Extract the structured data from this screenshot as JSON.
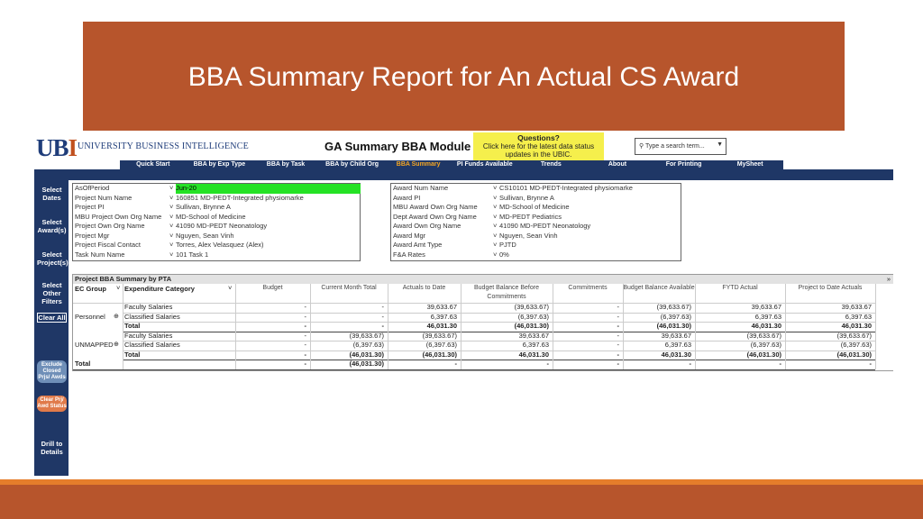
{
  "slide": {
    "title": "BBA Summary Report for An Actual CS Award"
  },
  "colors": {
    "banner": "#b7552c",
    "navy": "#1f3766",
    "highlight": "#25e225",
    "questions": "#f5ef4c",
    "strip": "#e57d2b"
  },
  "header": {
    "logo_u": "U",
    "logo_b": "B",
    "logo_i": "I",
    "subtitle": "UNIVERSITY BUSINESS INTELLIGENCE",
    "module_title": "GA Summary BBA Module",
    "questions_title": "Questions?",
    "questions_text": "Click here for the latest data status updates in the UBIC.",
    "search_placeholder": "Type a search term...",
    "search_icon": "search-icon"
  },
  "nav": [
    "Quick Start",
    "BBA by Exp Type",
    "BBA by Task",
    "BBA by Child Org",
    "BBA Summary",
    "PI Funds Available",
    "Trends",
    "About",
    "For Printing",
    "MySheet"
  ],
  "nav_active": "BBA Summary",
  "sidebar": {
    "select_dates": "Select Dates",
    "select_award": "Select Award(s)",
    "select_project": "Select Project(s)",
    "select_other": "Select Other Filters",
    "clear_all": "Clear All",
    "exclude": "Exclude Closed Prjs/ Awds",
    "clear_prj": "Clear Prj/ Awd Status",
    "drill": "Drill to Details"
  },
  "filters_left": [
    {
      "label": "AsOfPeriod",
      "value": "Jun-20",
      "highlight": true
    },
    {
      "label": "Project Num Name",
      "value": "160851 MD-PEDT-Integrated physiomarke"
    },
    {
      "label": "Project PI",
      "value": "Sullivan, Brynne A"
    },
    {
      "label": "MBU Project Own Org Name",
      "value": "MD-School of Medicine"
    },
    {
      "label": "Project Own Org Name",
      "value": "41090 MD-PEDT Neonatology"
    },
    {
      "label": "Project Mgr",
      "value": "Nguyen, Sean Vinh"
    },
    {
      "label": "Project Fiscal Contact",
      "value": "Torres, Alex Velasquez (Alex)"
    },
    {
      "label": "Task Num Name",
      "value": "101 Task 1"
    }
  ],
  "filters_right": [
    {
      "label": "Award Num Name",
      "value": "CS10101 MD-PEDT-Integrated physiomarke"
    },
    {
      "label": "Award PI",
      "value": "Sullivan, Brynne A"
    },
    {
      "label": "MBU Award Own Org Name",
      "value": "MD-School of Medicine"
    },
    {
      "label": "Dept Award Own Org Name",
      "value": "MD-PEDT Pediatrics"
    },
    {
      "label": "Award Own Org Name",
      "value": "41090 MD-PEDT Neonatology"
    },
    {
      "label": "Award Mgr",
      "value": "Nguyen, Sean Vinh"
    },
    {
      "label": "Award Amt Type",
      "value": "PJTD"
    },
    {
      "label": "F&A Rates",
      "value": "0%"
    }
  ],
  "table": {
    "title": "Project BBA Summary by PTA",
    "more": "»",
    "col_ec": "EC Group",
    "col_exp": "Expenditure Category",
    "columns": [
      "Budget",
      "Current Month Total",
      "Actuals to Date",
      "Budget Balance Before Commitments",
      "Commitments",
      "Budget Balance Available",
      "FYTD Actual",
      "Project to Date Actuals"
    ],
    "groups": [
      {
        "name": "Personnel",
        "rows": [
          {
            "cat": "Faculty Salaries",
            "vals": [
              "-",
              "-",
              "39,633.67",
              "(39,633.67)",
              "-",
              "(39,633.67)",
              "39,633.67",
              "39,633.67"
            ]
          },
          {
            "cat": "Classified Salaries",
            "vals": [
              "-",
              "-",
              "6,397.63",
              "(6,397.63)",
              "-",
              "(6,397.63)",
              "6,397.63",
              "6,397.63"
            ]
          },
          {
            "cat": "Total",
            "vals": [
              "-",
              "-",
              "46,031.30",
              "(46,031.30)",
              "-",
              "(46,031.30)",
              "46,031.30",
              "46,031.30"
            ],
            "bold": true
          }
        ]
      },
      {
        "name": "UNMAPPED",
        "rows": [
          {
            "cat": "Faculty Salaries",
            "vals": [
              "-",
              "(39,633.67)",
              "(39,633.67)",
              "39,633.67",
              "-",
              "39,633.67",
              "(39,633.67)",
              "(39,633.67)"
            ]
          },
          {
            "cat": "Classified Salaries",
            "vals": [
              "-",
              "(6,397.63)",
              "(6,397.63)",
              "6,397.63",
              "-",
              "6,397.63",
              "(6,397.63)",
              "(6,397.63)"
            ]
          },
          {
            "cat": "Total",
            "vals": [
              "-",
              "(46,031.30)",
              "(46,031.30)",
              "46,031.30",
              "-",
              "46,031.30",
              "(46,031.30)",
              "(46,031.30)"
            ],
            "bold": true
          }
        ]
      }
    ],
    "grand_total": {
      "label": "Total",
      "vals": [
        "-",
        "(46,031.30)",
        "-",
        "-",
        "-",
        "-",
        "-",
        "-"
      ]
    }
  }
}
